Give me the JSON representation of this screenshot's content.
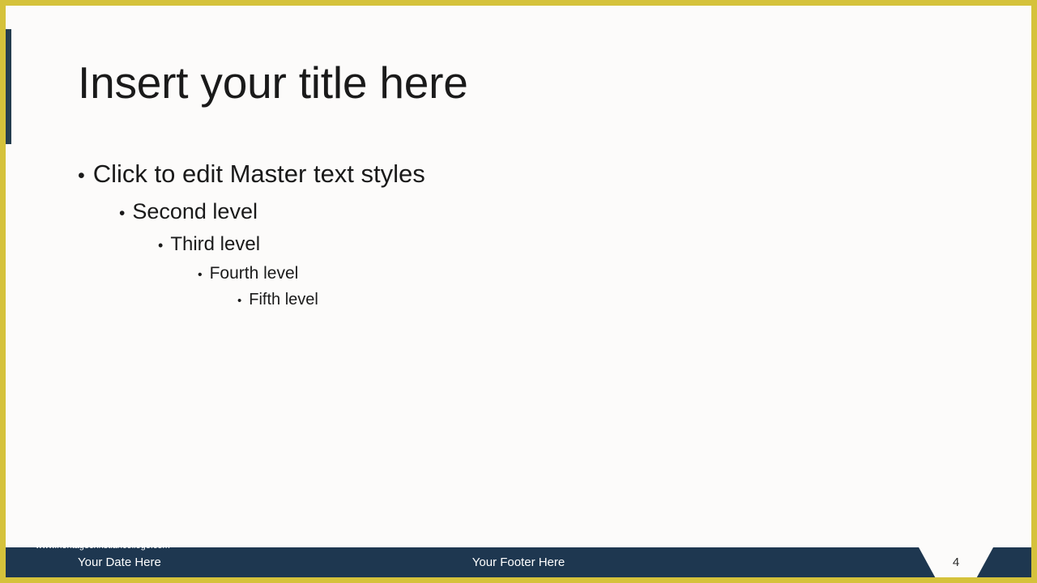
{
  "slide": {
    "title": "Insert your title here",
    "page_number": "4"
  },
  "body": {
    "bullet_char": "•",
    "levels": [
      {
        "label": "Click to edit Master text styles"
      },
      {
        "label": "Second level"
      },
      {
        "label": "Third level"
      },
      {
        "label": "Fourth level"
      },
      {
        "label": "Fifth level"
      }
    ]
  },
  "footer": {
    "website_url": "www.heritagechristiancollege.com",
    "date_placeholder": "Your Date Here",
    "footer_placeholder": "Your Footer Here"
  },
  "colors": {
    "border_gold": "#d5c23b",
    "footer_navy": "#1e3750",
    "accent_navy": "#253d4f",
    "background": "#fcfbfa",
    "text_dark": "#1a1a1a",
    "text_light": "#ffffff"
  }
}
